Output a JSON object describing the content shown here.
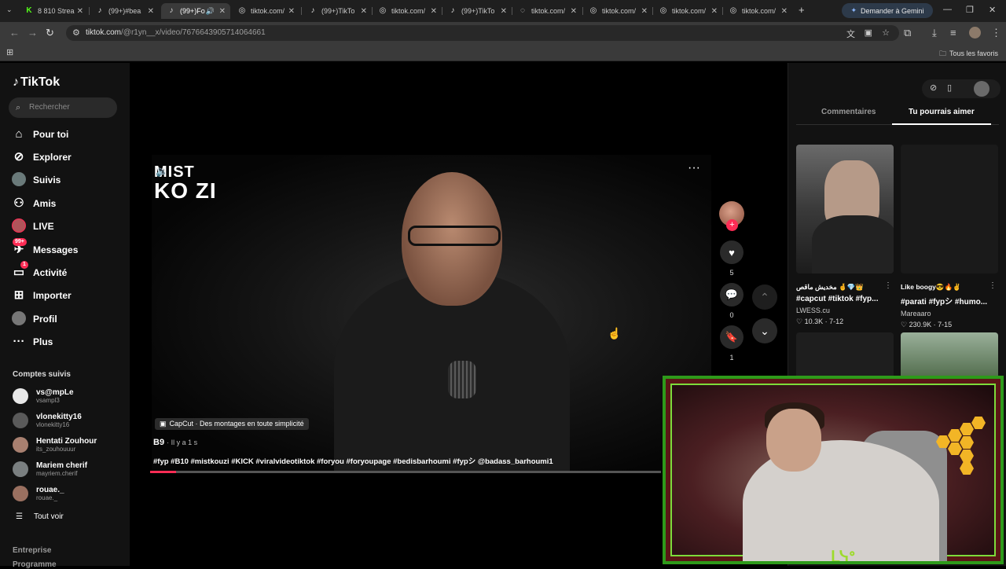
{
  "browser": {
    "tabs": [
      {
        "title": "8 810 Strea",
        "icon": "kick-icon",
        "active": false
      },
      {
        "title": "(99+)#bea",
        "icon": "tiktok-icon",
        "active": false
      },
      {
        "title": "(99+)Fo",
        "icon": "tiktok-icon",
        "active": true
      },
      {
        "title": "tiktok.com/",
        "icon": "globe-icon",
        "active": false
      },
      {
        "title": "(99+)TikTo",
        "icon": "tiktok-icon",
        "active": false
      },
      {
        "title": "tiktok.com/",
        "icon": "globe-icon",
        "active": false
      },
      {
        "title": "(99+)TikTo",
        "icon": "tiktok-icon",
        "active": false
      },
      {
        "title": "tiktok.com/",
        "icon": "loading-icon",
        "active": false
      },
      {
        "title": "tiktok.com/",
        "icon": "globe-icon",
        "active": false
      },
      {
        "title": "tiktok.com/",
        "icon": "globe-icon",
        "active": false
      },
      {
        "title": "tiktok.com/",
        "icon": "globe-icon",
        "active": false
      }
    ],
    "gemini_label": "Demander à Gemini",
    "url_domain": "tiktok.com",
    "url_path": "/@r1yn__x/video/7676643905714064661",
    "bookmarks_all": "Tous les favoris"
  },
  "sidebar": {
    "logo": "TikTok",
    "search_placeholder": "Rechercher",
    "nav": [
      {
        "label": "Pour toi",
        "icon": "home-icon"
      },
      {
        "label": "Explorer",
        "icon": "compass-icon"
      },
      {
        "label": "Suivis",
        "icon": "following-icon"
      },
      {
        "label": "Amis",
        "icon": "friends-icon"
      },
      {
        "label": "LIVE",
        "icon": "live-icon"
      },
      {
        "label": "Messages",
        "icon": "message-icon",
        "badge": "99+"
      },
      {
        "label": "Activité",
        "icon": "activity-icon",
        "badge": "1"
      },
      {
        "label": "Importer",
        "icon": "upload-icon"
      },
      {
        "label": "Profil",
        "icon": "profile-icon"
      },
      {
        "label": "Plus",
        "icon": "more-icon"
      }
    ],
    "followed_title": "Comptes suivis",
    "followed": [
      {
        "name": "vs@mpLe",
        "handle": "vsampl3"
      },
      {
        "name": "vlonekitty16",
        "handle": "vlonekitty16"
      },
      {
        "name": "Hentati Zouhour",
        "handle": "its_zouhouuur"
      },
      {
        "name": "Mariem cherif",
        "handle": "mayriem.cherif"
      },
      {
        "name": "rouae._",
        "handle": "rouae._"
      }
    ],
    "see_all": "Tout voir",
    "footer_1": "Entreprise",
    "footer_2": "Programme"
  },
  "video": {
    "brand_line1": "MIST",
    "brand_line2": "KO  ZI",
    "capcut": "CapCut · Des montages en toute simplicité",
    "author": "B9",
    "time": "· Il y a 1 s",
    "description": "#fyp #B10 #mistkouzi #KICK #viralvideotiktok #foryou #foryoupage #bedisbarhoumi #fypシ @badass_barhoumi1",
    "progress": 0.05,
    "likes": "5",
    "comments": "0",
    "saves": "1"
  },
  "right_panel": {
    "tab_comments": "Commentaires",
    "tab_suggestions": "Tu pourrais aimer",
    "cards": [
      {
        "title": "مخديش ماقص 🤞💎👑",
        "tags": "#capcut #tiktok #fyp...",
        "author": "LWESS.cu",
        "stats": "♡ 10.3K · 7-12"
      },
      {
        "title": "Like boogy😎🔥✌",
        "tags": "#parati #fypシ #humo...",
        "author": "Mareaaro",
        "stats": "♡ 230.9K · 7-15"
      }
    ]
  },
  "colors": {
    "accent": "#fe2c55",
    "webcam_border": "#2e9a1a"
  }
}
